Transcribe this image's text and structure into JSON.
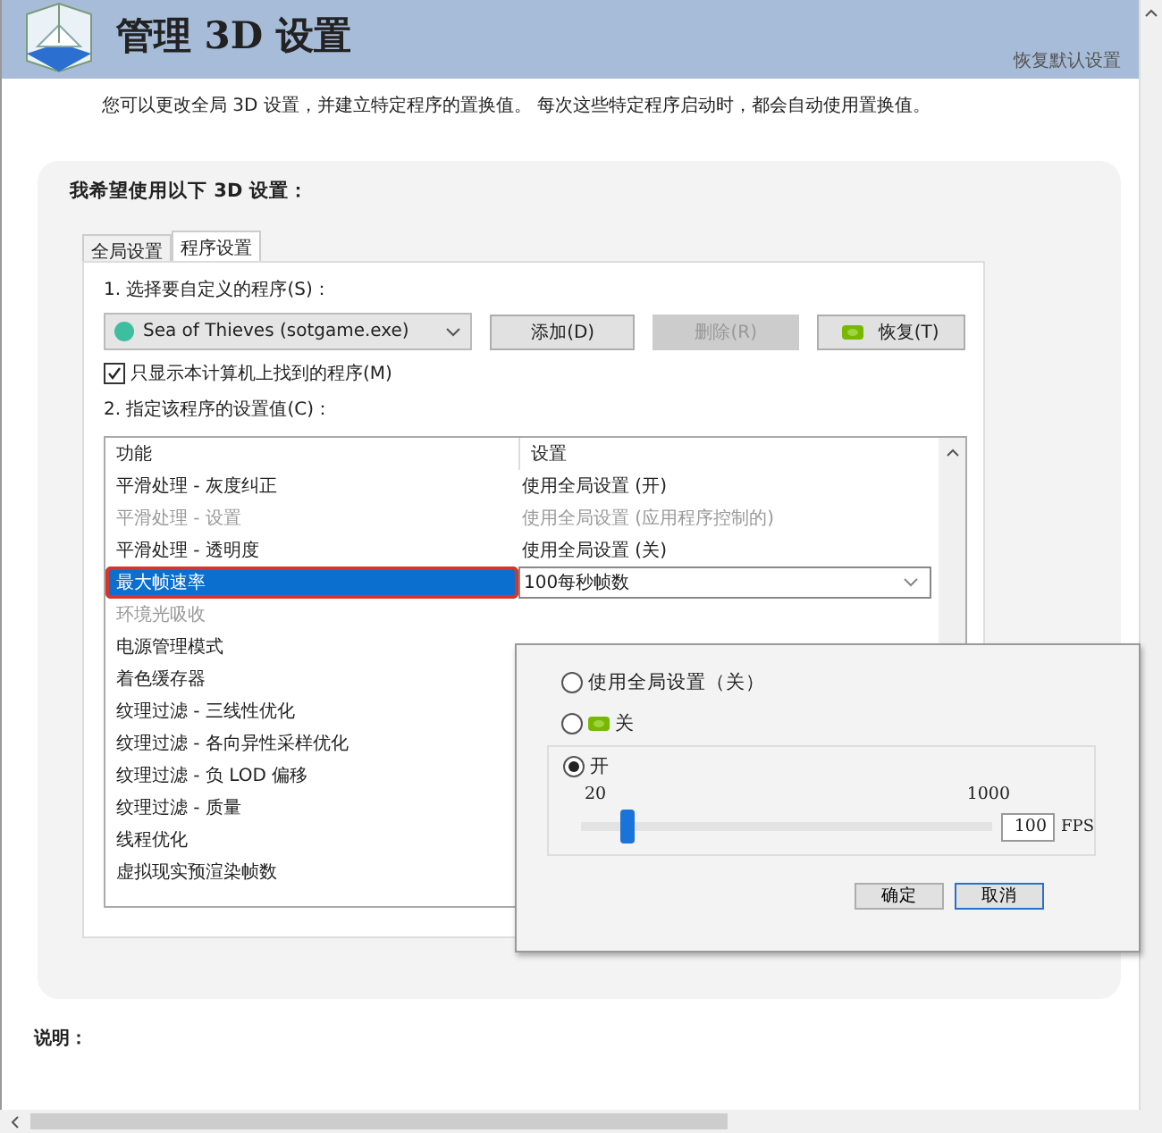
{
  "header": {
    "title": "管理 3D 设置",
    "restore_link": "恢复默认设置"
  },
  "intro": "您可以更改全局 3D 设置，并建立特定程序的置换值。 每次这些特定程序启动时，都会自动使用置换值。",
  "panel": {
    "title": "我希望使用以下 3D 设置：",
    "tabs": [
      {
        "label": "全局设置",
        "selected": false
      },
      {
        "label": "程序设置",
        "selected": true
      }
    ],
    "step1": "1. 选择要自定义的程序(S)：",
    "program": "Sea of Thieves (sotgame.exe)",
    "buttons": [
      {
        "label": "添加(D)",
        "disabled": false,
        "kind": "plain"
      },
      {
        "label": "删除(R)",
        "disabled": true,
        "kind": "plain"
      },
      {
        "label": "恢复(T)",
        "disabled": false,
        "kind": "logo"
      }
    ],
    "only_found": {
      "label": "只显示本计算机上找到的程序(M)",
      "checked": true
    },
    "step2": "2. 指定该程序的设置值(C)：",
    "table": {
      "columns": [
        "功能",
        "设置"
      ],
      "rows": [
        {
          "feature": "平滑处理 - 灰度纠正",
          "setting": "使用全局设置 (开)",
          "disabled": false,
          "selected": false,
          "highlighted": false
        },
        {
          "feature": "平滑处理 - 设置",
          "setting": "使用全局设置 (应用程序控制的)",
          "disabled": true,
          "selected": false,
          "highlighted": false
        },
        {
          "feature": "平滑处理 - 透明度",
          "setting": "使用全局设置 (关)",
          "disabled": false,
          "selected": false,
          "highlighted": false
        },
        {
          "feature": "最大帧速率",
          "setting": "100每秒帧数",
          "disabled": false,
          "selected": true,
          "highlighted": true
        },
        {
          "feature": "环境光吸收",
          "disabled": true,
          "selected": false,
          "highlighted": false
        },
        {
          "feature": "电源管理模式",
          "disabled": false,
          "selected": false,
          "highlighted": false
        },
        {
          "feature": "着色缓存器",
          "disabled": false,
          "selected": false,
          "highlighted": false
        },
        {
          "feature": "纹理过滤 - 三线性优化",
          "disabled": false,
          "selected": false,
          "highlighted": false
        },
        {
          "feature": "纹理过滤 - 各向异性采样优化",
          "disabled": false,
          "selected": false,
          "highlighted": false
        },
        {
          "feature": "纹理过滤 - 负 LOD 偏移",
          "disabled": false,
          "selected": false,
          "highlighted": false
        },
        {
          "feature": "纹理过滤 - 质量",
          "disabled": false,
          "selected": false,
          "highlighted": false
        },
        {
          "feature": "线程优化",
          "disabled": false,
          "selected": false,
          "highlighted": false
        },
        {
          "feature": "虚拟现实预渲染帧数",
          "disabled": false,
          "selected": false,
          "highlighted": false
        }
      ]
    }
  },
  "popup": {
    "options": [
      {
        "label": "使用全局设置（关）",
        "selected": false,
        "logo": false
      },
      {
        "label": "关",
        "selected": false,
        "logo": true
      },
      {
        "label": "开",
        "selected": true,
        "logo": false
      }
    ],
    "slider": {
      "min_label": "20",
      "max_label": "1000",
      "level": 0.08,
      "value": "100",
      "unit": "FPS"
    },
    "buttons": [
      {
        "label": "确定",
        "focused": false
      },
      {
        "label": "取消",
        "focused": true
      }
    ]
  },
  "description_label": "说明："
}
